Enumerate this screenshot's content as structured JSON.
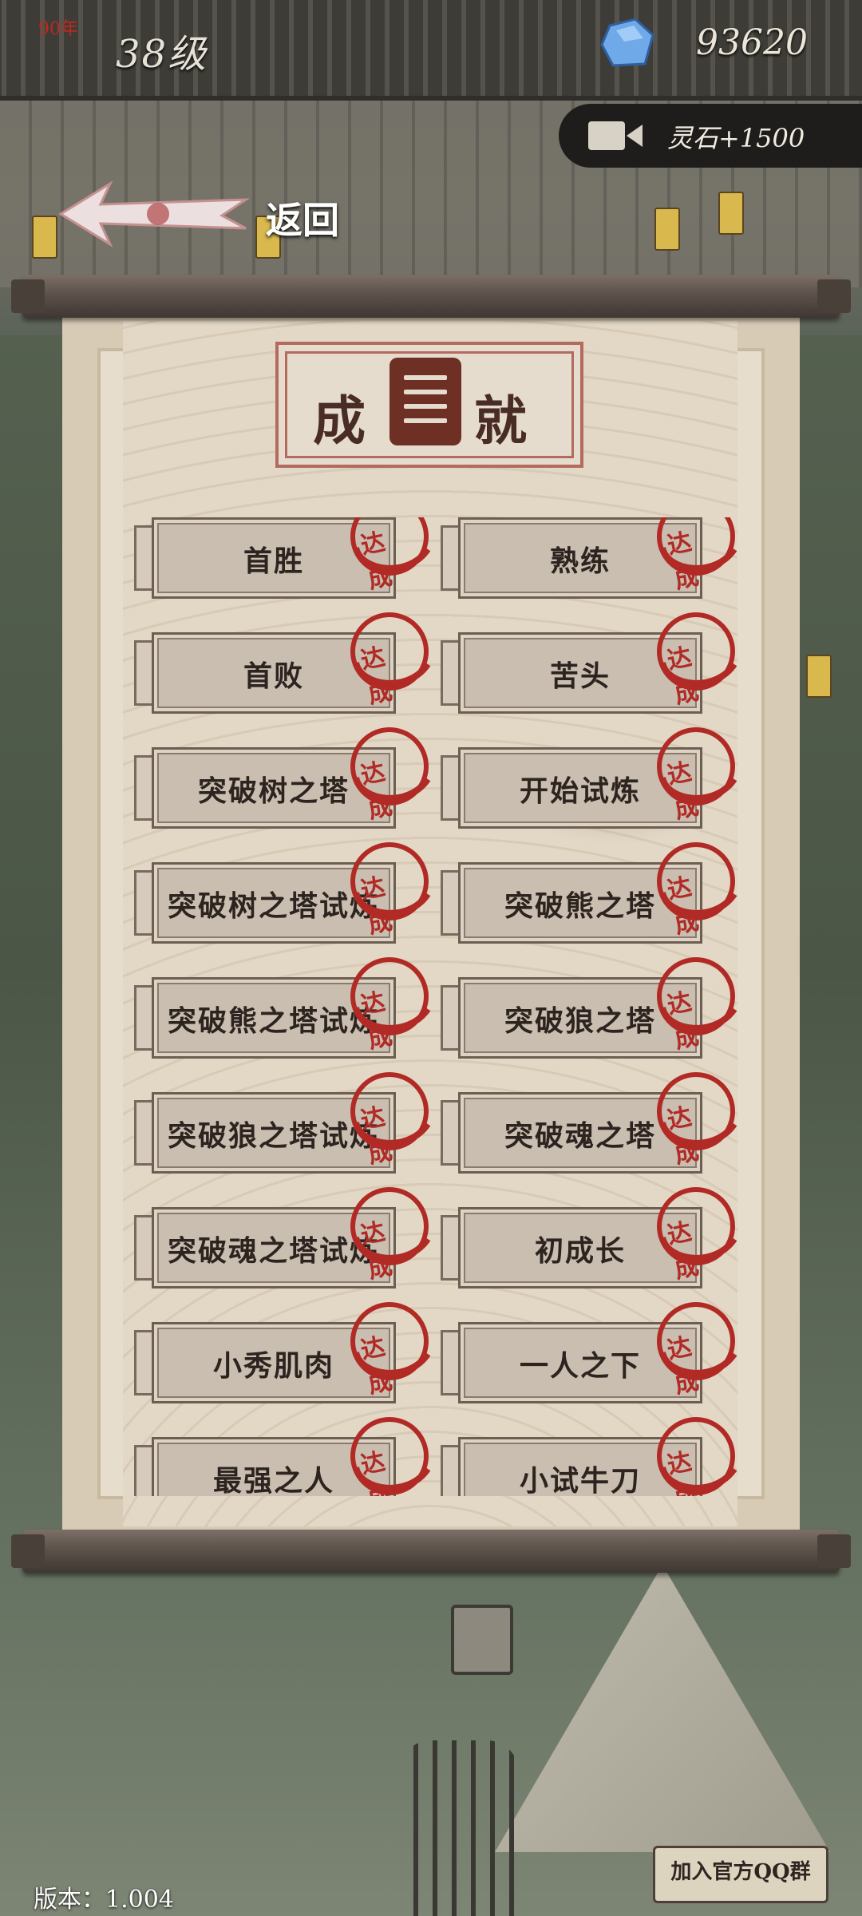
{
  "hud": {
    "level_mark": "90年",
    "level": "38级",
    "stone_amount": "93620",
    "ad_reward": "灵石+1500"
  },
  "nav": {
    "back_label": "返回"
  },
  "panel": {
    "title_left": "成",
    "title_right": "就",
    "stamp_label": "达成",
    "achievements": [
      {
        "name": "首胜"
      },
      {
        "name": "熟练"
      },
      {
        "name": "首败"
      },
      {
        "name": "苦头"
      },
      {
        "name": "突破树之塔"
      },
      {
        "name": "开始试炼"
      },
      {
        "name": "突破树之塔试炼"
      },
      {
        "name": "突破熊之塔"
      },
      {
        "name": "突破熊之塔试炼"
      },
      {
        "name": "突破狼之塔"
      },
      {
        "name": "突破狼之塔试炼"
      },
      {
        "name": "突破魂之塔"
      },
      {
        "name": "突破魂之塔试炼"
      },
      {
        "name": "初成长"
      },
      {
        "name": "小秀肌肉"
      },
      {
        "name": "一人之下"
      },
      {
        "name": "最强之人"
      },
      {
        "name": "小试牛刀"
      }
    ]
  },
  "footer": {
    "version": "版本：1.004",
    "qq_group_button": "加入官方QQ群"
  },
  "colors": {
    "stamp_red": "#b12a25",
    "paper": "#e3d8c6",
    "plate": "#c9beb0"
  }
}
